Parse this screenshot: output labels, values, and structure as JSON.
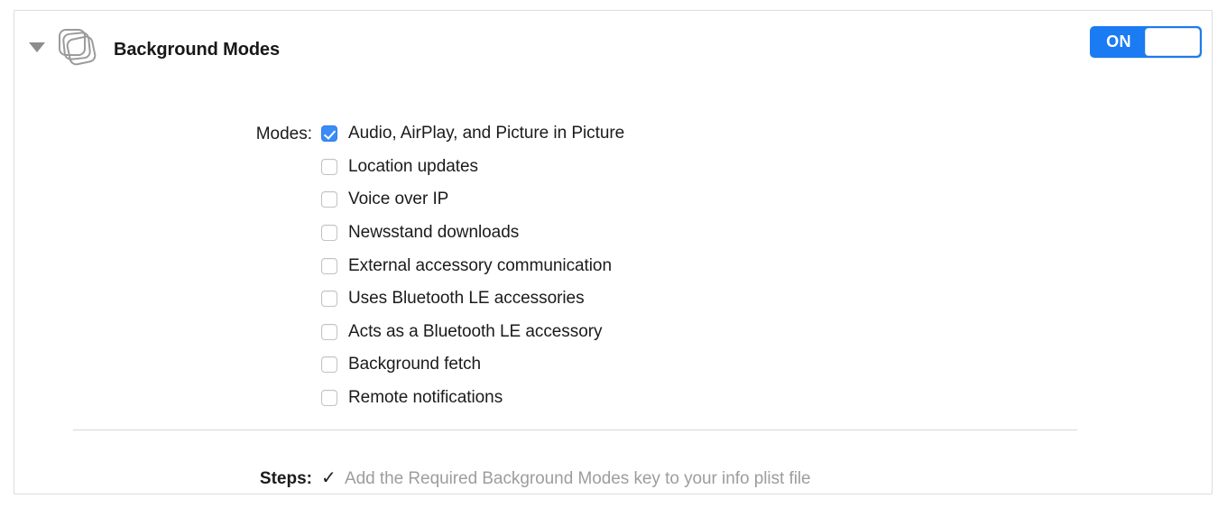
{
  "panel": {
    "title": "Background Modes",
    "icon_name": "stacked-cards-icon",
    "disclosure_state": "expanded"
  },
  "toggle": {
    "label": "ON",
    "state": "on",
    "accent_color": "#1a7bf2"
  },
  "modes": {
    "label": "Modes:",
    "checked_color": "#3b8cf5",
    "items": [
      {
        "label": "Audio, AirPlay, and Picture in Picture",
        "checked": true
      },
      {
        "label": "Location updates",
        "checked": false
      },
      {
        "label": "Voice over IP",
        "checked": false
      },
      {
        "label": "Newsstand downloads",
        "checked": false
      },
      {
        "label": "External accessory communication",
        "checked": false
      },
      {
        "label": "Uses Bluetooth LE accessories",
        "checked": false
      },
      {
        "label": "Acts as a Bluetooth LE accessory",
        "checked": false
      },
      {
        "label": "Background fetch",
        "checked": false
      },
      {
        "label": "Remote notifications",
        "checked": false
      }
    ]
  },
  "steps": {
    "label": "Steps:",
    "check_glyph": "✓",
    "text": "Add the Required Background Modes key to your info plist file",
    "text_color": "#9d9d9d"
  }
}
